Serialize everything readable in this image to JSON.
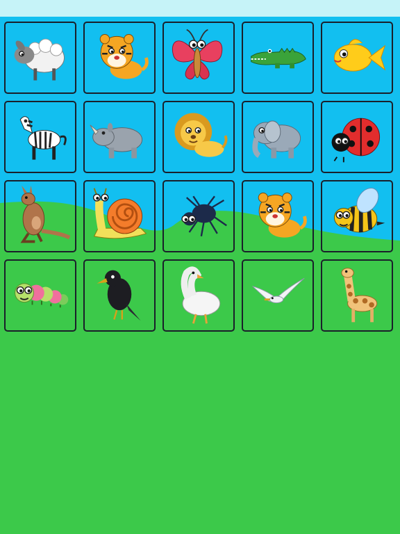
{
  "colors": {
    "sky": "#12bff0",
    "grass": "#3cc94a",
    "status_bar": "#c6f3f8",
    "tile_border": "#1a1f2a"
  },
  "grid": {
    "columns": 5,
    "rows": 4,
    "tiles": [
      {
        "animal": "sheep",
        "icon": "sheep-icon"
      },
      {
        "animal": "tiger",
        "icon": "tiger-icon"
      },
      {
        "animal": "butterfly",
        "icon": "butterfly-icon"
      },
      {
        "animal": "crocodile",
        "icon": "crocodile-icon"
      },
      {
        "animal": "goldfish",
        "icon": "goldfish-icon"
      },
      {
        "animal": "zebra",
        "icon": "zebra-icon"
      },
      {
        "animal": "rhinoceros",
        "icon": "rhinoceros-icon"
      },
      {
        "animal": "lion",
        "icon": "lion-icon"
      },
      {
        "animal": "elephant",
        "icon": "elephant-icon"
      },
      {
        "animal": "ladybug",
        "icon": "ladybug-icon"
      },
      {
        "animal": "kangaroo",
        "icon": "kangaroo-icon"
      },
      {
        "animal": "snail",
        "icon": "snail-icon"
      },
      {
        "animal": "spider",
        "icon": "spider-icon"
      },
      {
        "animal": "tiger",
        "icon": "tiger-icon"
      },
      {
        "animal": "bee",
        "icon": "bee-icon"
      },
      {
        "animal": "caterpillar",
        "icon": "caterpillar-icon"
      },
      {
        "animal": "crow",
        "icon": "crow-icon"
      },
      {
        "animal": "goose",
        "icon": "goose-icon"
      },
      {
        "animal": "seagull",
        "icon": "seagull-icon"
      },
      {
        "animal": "giraffe",
        "icon": "giraffe-icon"
      }
    ]
  }
}
